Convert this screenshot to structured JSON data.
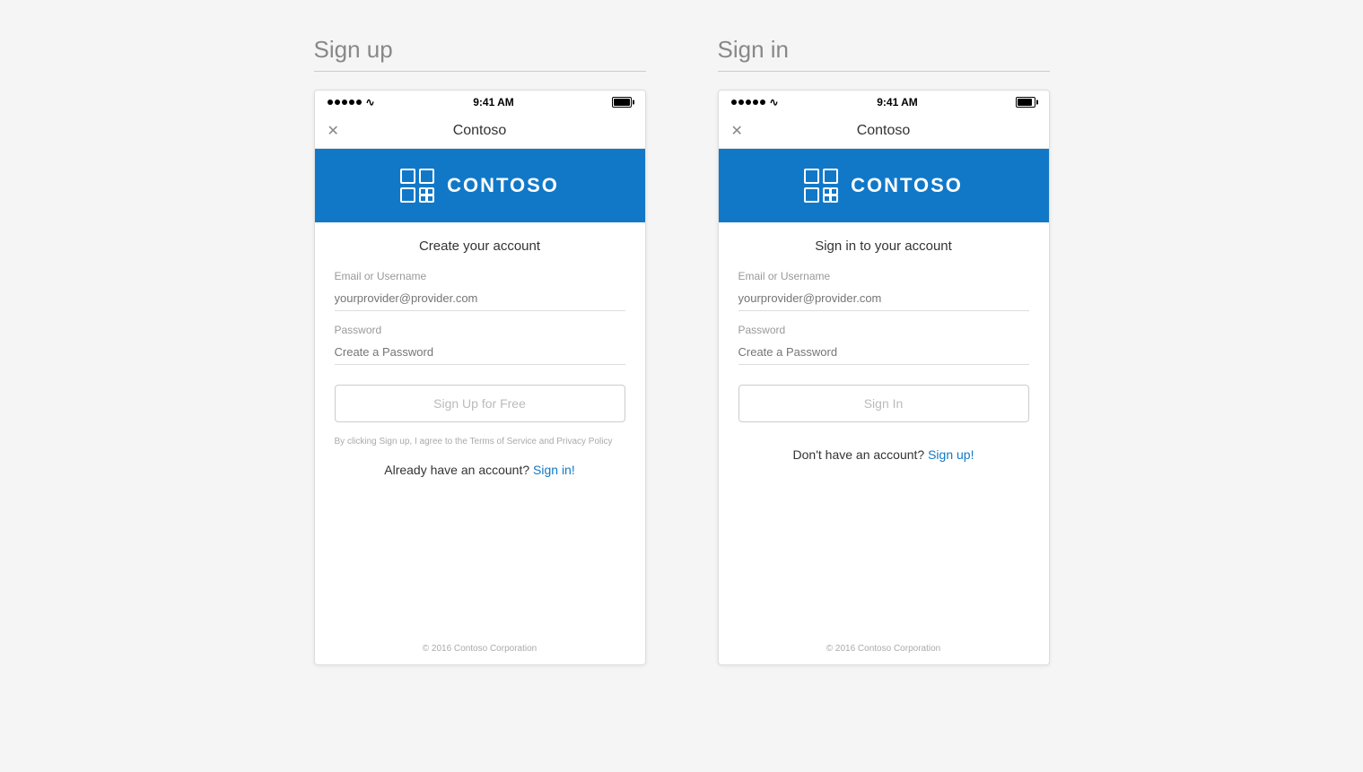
{
  "signup": {
    "panel_title": "Sign up",
    "nav_title": "Contoso",
    "app_name": "CONTOSO",
    "form_heading": "Create your account",
    "email_label": "Email or Username",
    "email_placeholder": "yourprovider@provider.com",
    "password_label": "Password",
    "password_placeholder": "Create a Password",
    "button_label": "Sign Up for Free",
    "terms_text": "By clicking Sign up, I agree to the Terms of Service and Privacy Policy",
    "bottom_text": "Already have an account?",
    "bottom_link": "Sign in!",
    "footer_text": "© 2016 Contoso Corporation",
    "status_time": "9:41 AM"
  },
  "signin": {
    "panel_title": "Sign in",
    "nav_title": "Contoso",
    "app_name": "CONTOSO",
    "form_heading": "Sign in to your account",
    "email_label": "Email or Username",
    "email_placeholder": "yourprovider@provider.com",
    "password_label": "Password",
    "password_placeholder": "Create a Password",
    "button_label": "Sign In",
    "bottom_text": "Don't have an account?",
    "bottom_link": "Sign up!",
    "footer_text": "© 2016 Contoso Corporation",
    "status_time": "9:41 AM"
  },
  "colors": {
    "brand_blue": "#1178C8",
    "link_blue": "#1178C8"
  }
}
